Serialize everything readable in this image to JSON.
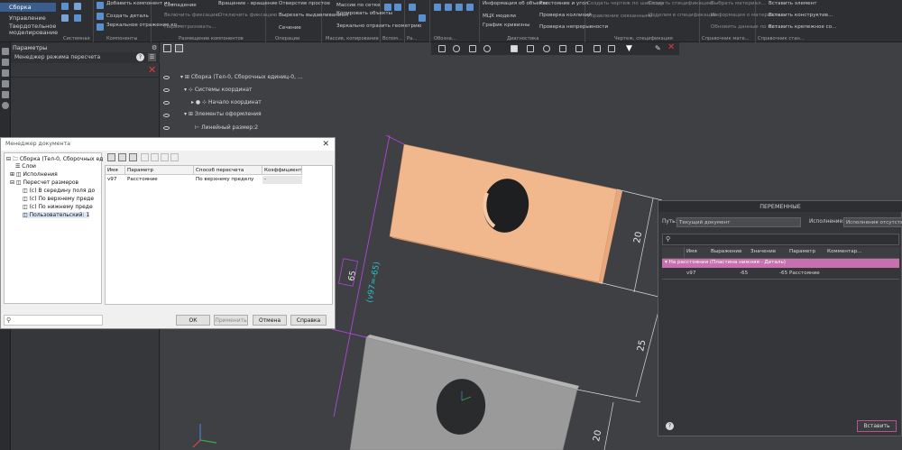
{
  "ribbon": {
    "tabs": [
      "Сборка",
      "Управление",
      "Твердотельное моделирование"
    ],
    "groups": [
      {
        "label": "Системная",
        "buttons": []
      },
      {
        "label": "Компоненты",
        "buttons": [
          "Добавить компонент из...",
          "Создать деталь",
          "Зеркальное отражение ко..."
        ]
      },
      {
        "label": "Размещение компонентов",
        "buttons": [
          "Совпадение",
          "Вращение - вращение",
          "Включить фиксацию",
          "Отключить фиксацию",
          "Параметризовать..."
        ]
      },
      {
        "label": "Операции",
        "buttons": [
          "Отверстие простое",
          "Вырезать выдавливанием",
          "Сечение"
        ]
      },
      {
        "label": "Массив, копирование",
        "buttons": [
          "Массив по сетке",
          "Копировать объекты",
          "Зеркально отразить геометрию"
        ]
      },
      {
        "label": "Вспом...",
        "buttons": []
      },
      {
        "label": "Ра...",
        "buttons": []
      },
      {
        "label": "Обозна...",
        "buttons": []
      },
      {
        "label": "Диагностика",
        "buttons": [
          "Информация об объекте",
          "МЦХ модели",
          "График кривизны",
          "Расстояние и угол",
          "Проверка коллизий",
          "Проверка непрерывности"
        ]
      },
      {
        "label": "Чертеж, спецификация",
        "buttons": [
          "Создать чертеж по шаблону",
          "Управление связанными ...",
          "Создать спецификацию",
          "Изделия в спецификации"
        ]
      },
      {
        "label": "Справочник мате...",
        "buttons": [
          "Выбрать материал...",
          "Информация о материале...",
          "Обновить данные по мат..."
        ]
      },
      {
        "label": "Справочник стан...",
        "buttons": [
          "Вставить элемент",
          "Вставить конструктив...",
          "Вставить крепежное со..."
        ]
      }
    ]
  },
  "params_panel": {
    "title": "Параметры",
    "subtitle": "Менеджер режима пересчета"
  },
  "tree": [
    {
      "label": "Сборка (Тел-0, Сборочных единиц-0, ..."
    },
    {
      "label": "Системы координат"
    },
    {
      "label": "Начало координат"
    },
    {
      "label": "Элементы оформления"
    },
    {
      "label": "Линейный размер:2"
    }
  ],
  "doc_manager": {
    "title": "Менеджер документа",
    "tree": [
      "Сборка (Тел-0, Сборочных ед",
      "Слои",
      "Исполнения",
      "Пересчет размеров",
      "(с) В середину поля до",
      "(с) По верхнему преде",
      "(с) По нижнему преде",
      "Пользовательский: 1"
    ],
    "columns": [
      "Имя",
      "Параметр",
      "Способ пересчета",
      "Коэффициент"
    ],
    "rows": [
      {
        "name": "v97",
        "param": "Расстояние",
        "method": "По верхнему пределу",
        "coef": "-"
      }
    ],
    "buttons": {
      "ok": "ОК",
      "apply": "Применить",
      "cancel": "Отмена",
      "help": "Справка"
    }
  },
  "variables": {
    "title": "ПЕРЕМЕННЫЕ",
    "path_label": "Путь:",
    "path_value": "Текущий документ",
    "exec_label": "Исполнение:",
    "exec_value": "Исполнения отсутству",
    "columns": [
      "Имя",
      "Выражение",
      "Значение",
      "Параметр",
      "Комментар..."
    ],
    "group_row": "На расстоянии (Пластина нижняя - Деталь)",
    "rows": [
      {
        "name": "v97",
        "expr": "-65",
        "value": "-65",
        "param": "Расстояние",
        "comment": ""
      }
    ],
    "insert_button": "Вставить",
    "help_icon": "?"
  },
  "dimensions": {
    "angled": "(v97=-65)",
    "angled_box": "65",
    "d1": "20",
    "d2": "25",
    "d3": "20"
  },
  "colors": {
    "accent": "#3a5f8f",
    "part_top": "#f2b88d",
    "part_bottom": "#9a9a9a",
    "dimension_highlight": "#b146d8",
    "variable_group": "#c86fb0"
  }
}
